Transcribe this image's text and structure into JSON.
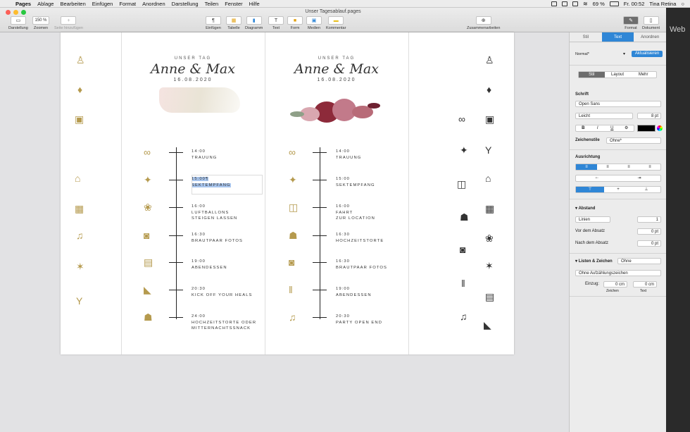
{
  "menubar": {
    "app": "Pages",
    "items": [
      "Ablage",
      "Bearbeiten",
      "Einfügen",
      "Format",
      "Anordnen",
      "Darstellung",
      "Teilen",
      "Fenster",
      "Hilfe"
    ],
    "battery": "69 %",
    "clock": "Fr. 00:52",
    "user": "Tina Retina"
  },
  "window": {
    "title": "Unser Tagesablauf.pages"
  },
  "toolbar": {
    "darstellung": "Darstellung",
    "zoom_value": "150 %",
    "zoomen": "Zoomen",
    "seite_add": "Seite hinzufügen",
    "einfuegen": "Einfügen",
    "tabelle": "Tabelle",
    "diagramm": "Diagramm",
    "text": "Text",
    "form": "Form",
    "medien": "Medien",
    "kommentar": "Kommentar",
    "zusammenarbeiten": "Zusammenarbeiten",
    "format": "Format",
    "dokument": "Dokument"
  },
  "page": {
    "left": {
      "ut": "UNSER TAG",
      "names": "Anne & Max",
      "date": "16.08.2020",
      "events": [
        {
          "time": "14:00",
          "lines": [
            "TRAUUNG"
          ]
        },
        {
          "time": "15:00¶",
          "lines": [
            "SEKTEMPFANG"
          ]
        },
        {
          "time": "16:00",
          "lines": [
            "LUFTBALLONS",
            "STEIGEN LASSEN"
          ]
        },
        {
          "time": "16:30",
          "lines": [
            "BRAUTPAAR FOTOS"
          ]
        },
        {
          "time": "19:00",
          "lines": [
            "ABENDESSEN"
          ]
        },
        {
          "time": "20:30",
          "lines": [
            "KICK OFF YOUR HEALS"
          ]
        },
        {
          "time": "24:00",
          "lines": [
            "HOCHZEITSTORTE ODER",
            "MITTERNACHTSSNACK"
          ]
        }
      ]
    },
    "right": {
      "ut": "UNSER TAG",
      "names": "Anne & Max",
      "date": "16.08.2020",
      "events": [
        {
          "time": "14:00",
          "lines": [
            "TRAUUNG"
          ]
        },
        {
          "time": "15:00",
          "lines": [
            "SEKTEMPFANG"
          ]
        },
        {
          "time": "16:00",
          "lines": [
            "FAHRT",
            "ZUR LOCATION"
          ]
        },
        {
          "time": "16:30",
          "lines": [
            "HOCHZEITSTORTE"
          ]
        },
        {
          "time": "16:30",
          "lines": [
            "BRAUTPAAR FOTOS"
          ]
        },
        {
          "time": "19:00",
          "lines": [
            "ABENDESSEN"
          ]
        },
        {
          "time": "20:30",
          "lines": [
            "PARTY OPEN END"
          ]
        }
      ]
    }
  },
  "inspector": {
    "tabs": [
      "Stil",
      "Text",
      "Anordnen"
    ],
    "style": "Normal*",
    "update": "Aktualisieren",
    "subtabs": [
      "Stil",
      "Layout",
      "Mehr"
    ],
    "schrift": "Schrift",
    "font": "Open Sans",
    "weight": "Leicht",
    "size": "8 pt",
    "zeichenstile": "Zeichenstile",
    "zeichenstile_val": "Ohne*",
    "ausrichtung": "Ausrichtung",
    "abstand": "Abstand",
    "linien": "Linien",
    "linien_val": "1",
    "vor": "Vor dem Absatz",
    "vor_val": "0 pt",
    "nach": "Nach dem Absatz",
    "nach_val": "0 pt",
    "listen": "Listen & Zeichen",
    "listen_val": "Ohne",
    "aufz": "Ohne Aufzählungszeichen",
    "einzug": "Einzug:",
    "einzug_z": "0 cm",
    "einzug_t": "0 cm",
    "zeichen": "Zeichen",
    "textlbl": "Text",
    "bius": [
      "B",
      "I",
      "U",
      "S"
    ]
  },
  "side": {
    "web": "Web"
  },
  "colors": {
    "accent": "#2f86d6",
    "gold": "#b59a4e"
  }
}
